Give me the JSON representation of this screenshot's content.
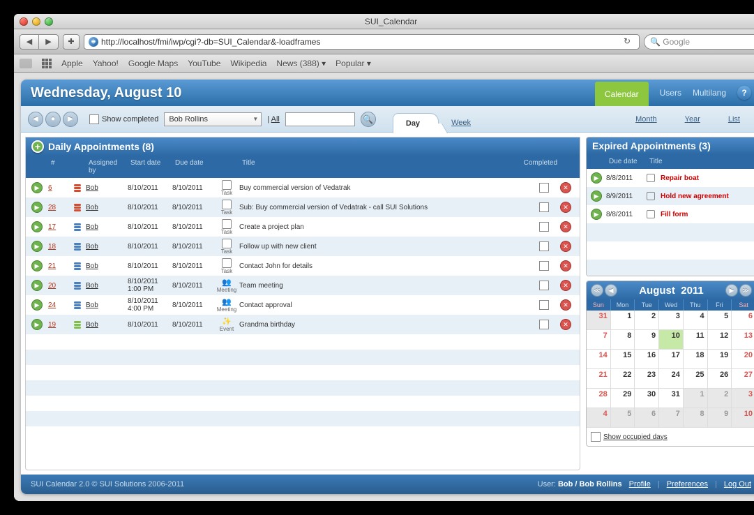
{
  "window": {
    "title": "SUI_Calendar"
  },
  "browser": {
    "url": "http://localhost/fmi/iwp/cgi?-db=SUI_Calendar&-loadframes",
    "search_placeholder": "Google",
    "bookmarks": [
      "Apple",
      "Yahoo!",
      "Google Maps",
      "YouTube",
      "Wikipedia",
      "News (388)",
      "Popular"
    ]
  },
  "header": {
    "date_title": "Wednesday, August 10",
    "nav": {
      "calendar": "Calendar",
      "users": "Users",
      "multilang": "Multilang"
    }
  },
  "controls": {
    "show_completed": "Show completed",
    "assigned_select": "Bob Rollins",
    "all_link": "All",
    "tabs": {
      "day": "Day",
      "week": "Week",
      "month": "Month",
      "year": "Year",
      "list": "List"
    }
  },
  "daily": {
    "title": "Daily Appointments (8)",
    "cols": {
      "num": "#",
      "by": "Assigned by",
      "sd": "Start date",
      "dd": "Due date",
      "title": "Title",
      "comp": "Completed"
    },
    "rows": [
      {
        "num": "6",
        "prio": "red",
        "by": "Bob",
        "sd": "8/10/2011",
        "sdtime": "",
        "dd": "8/10/2011",
        "type": "Task",
        "title": "Buy commercial version of Vedatrak"
      },
      {
        "num": "28",
        "prio": "red",
        "by": "Bob",
        "sd": "8/10/2011",
        "sdtime": "",
        "dd": "8/10/2011",
        "type": "Task",
        "title": "Sub: Buy commercial version of Vedatrak - call SUI Solutions"
      },
      {
        "num": "17",
        "prio": "blue",
        "by": "Bob",
        "sd": "8/10/2011",
        "sdtime": "",
        "dd": "8/10/2011",
        "type": "Task",
        "title": "Create a project plan"
      },
      {
        "num": "18",
        "prio": "blue",
        "by": "Bob",
        "sd": "8/10/2011",
        "sdtime": "",
        "dd": "8/10/2011",
        "type": "Task",
        "title": "Follow up with new client"
      },
      {
        "num": "21",
        "prio": "blue",
        "by": "Bob",
        "sd": "8/10/2011",
        "sdtime": "",
        "dd": "8/10/2011",
        "type": "Task",
        "title": "Contact John for details"
      },
      {
        "num": "20",
        "prio": "blue",
        "by": "Bob",
        "sd": "8/10/2011",
        "sdtime": "1:00 PM",
        "dd": "8/10/2011",
        "type": "Meeting",
        "title": "Team meeting"
      },
      {
        "num": "24",
        "prio": "blue",
        "by": "Bob",
        "sd": "8/10/2011",
        "sdtime": "4:00 PM",
        "dd": "8/10/2011",
        "type": "Meeting",
        "title": "Contact approval"
      },
      {
        "num": "19",
        "prio": "grn",
        "by": "Bob",
        "sd": "8/10/2011",
        "sdtime": "",
        "dd": "8/10/2011",
        "type": "Event",
        "title": "Grandma birthday"
      }
    ]
  },
  "expired": {
    "title": "Expired Appointments (3)",
    "cols": {
      "dd": "Due date",
      "title": "Title"
    },
    "rows": [
      {
        "dd": "8/8/2011",
        "title": "Repair boat"
      },
      {
        "dd": "8/9/2011",
        "title": "Hold new agreement"
      },
      {
        "dd": "8/8/2011",
        "title": "Fill form"
      }
    ]
  },
  "calendar": {
    "month": "August",
    "year": "2011",
    "days": [
      "Sun",
      "Mon",
      "Tue",
      "Wed",
      "Thu",
      "Fri",
      "Sat"
    ],
    "grid": [
      {
        "d": "31",
        "om": true,
        "we": true
      },
      {
        "d": "1"
      },
      {
        "d": "2"
      },
      {
        "d": "3"
      },
      {
        "d": "4"
      },
      {
        "d": "5"
      },
      {
        "d": "6",
        "we": true
      },
      {
        "d": "7",
        "we": true
      },
      {
        "d": "8"
      },
      {
        "d": "9"
      },
      {
        "d": "10",
        "today": true
      },
      {
        "d": "11"
      },
      {
        "d": "12"
      },
      {
        "d": "13",
        "we": true
      },
      {
        "d": "14",
        "we": true
      },
      {
        "d": "15"
      },
      {
        "d": "16"
      },
      {
        "d": "17"
      },
      {
        "d": "18"
      },
      {
        "d": "19"
      },
      {
        "d": "20",
        "we": true
      },
      {
        "d": "21",
        "we": true
      },
      {
        "d": "22"
      },
      {
        "d": "23"
      },
      {
        "d": "24"
      },
      {
        "d": "25"
      },
      {
        "d": "26"
      },
      {
        "d": "27",
        "we": true
      },
      {
        "d": "28",
        "we": true
      },
      {
        "d": "29"
      },
      {
        "d": "30"
      },
      {
        "d": "31"
      },
      {
        "d": "1",
        "om": true
      },
      {
        "d": "2",
        "om": true
      },
      {
        "d": "3",
        "om": true,
        "we": true
      },
      {
        "d": "4",
        "om": true,
        "we": true
      },
      {
        "d": "5",
        "om": true
      },
      {
        "d": "6",
        "om": true
      },
      {
        "d": "7",
        "om": true
      },
      {
        "d": "8",
        "om": true
      },
      {
        "d": "9",
        "om": true
      },
      {
        "d": "10",
        "om": true,
        "we": true
      }
    ],
    "show_occupied": "Show occupied days"
  },
  "footer": {
    "copy": "SUI Calendar 2.0 © SUI Solutions 2006-2011",
    "user_label": "User:",
    "user": "Bob / Bob Rollins",
    "profile": "Profile",
    "prefs": "Preferences",
    "logout": "Log Out"
  }
}
